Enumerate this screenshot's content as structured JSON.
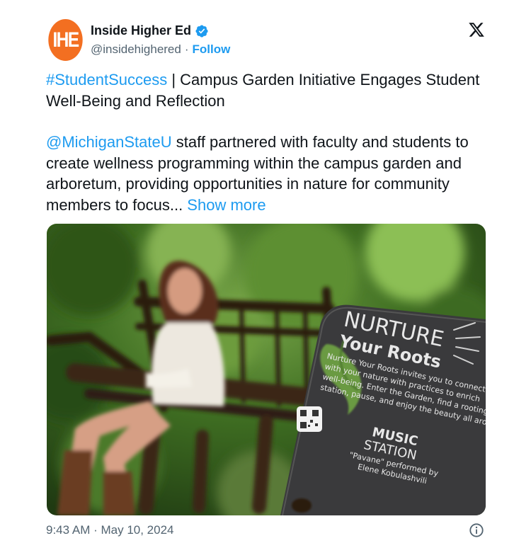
{
  "author": {
    "avatar_text": "IHE",
    "name": "Inside Higher Ed",
    "handle": "@insidehighered",
    "separator": "·",
    "follow_label": "Follow"
  },
  "tweet": {
    "hashtag": "#StudentSuccess",
    "title_rest": " | Campus Garden Initiative Engages Student Well-Being and Reflection",
    "mention": "@MichiganStateU",
    "body": " staff partnered with faculty and students to create wellness programming within the campus garden and arboretum, providing opportunities in nature for community members to focus... ",
    "show_more": "Show more"
  },
  "photo": {
    "sign_title_1": "NURTURE",
    "sign_title_2": "Your Roots",
    "sign_body": [
      "Nurture Your Roots invites you to connect",
      "with your nature with practices to enrich",
      "well-being. Enter the Garden, find a rooting",
      "station, pause, and enjoy the beauty all around."
    ],
    "sign_music_1": "MUSIC",
    "sign_music_2": "STATION",
    "sign_credit_1": "\"Pavane\" performed by",
    "sign_credit_2": "Elene Kobulashvili"
  },
  "footer": {
    "timestamp": "9:43 AM · May 10, 2024"
  },
  "colors": {
    "accent": "#1d9bf0",
    "avatar_bg": "#f36f21",
    "muted": "#536471"
  },
  "icons": {
    "verified": "verified-badge-icon",
    "x_logo": "x-logo-icon",
    "info": "info-icon"
  }
}
